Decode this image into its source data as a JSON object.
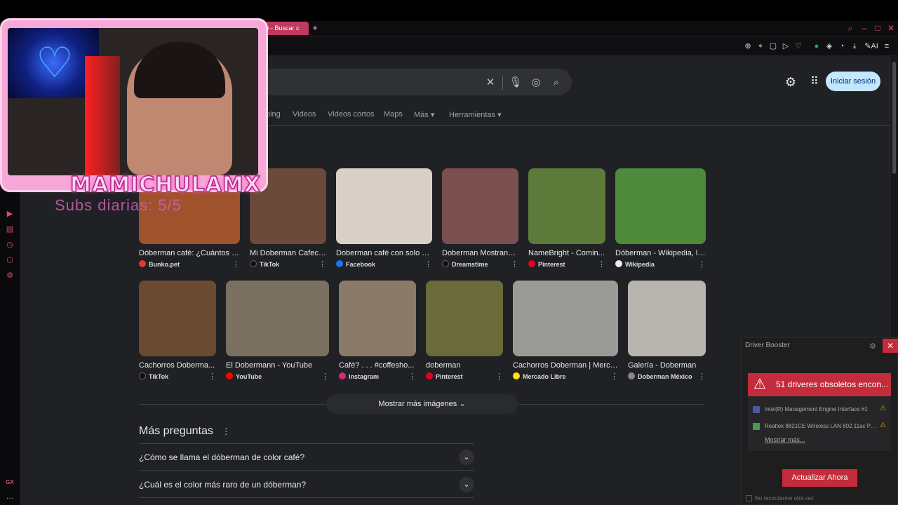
{
  "browser": {
    "active_tab_title": "fe - Buscar c",
    "new_tab_icon": "plus-icon"
  },
  "google": {
    "signin_label": "Iniciar sesión",
    "nav_tabs": [
      "ping",
      "Videos",
      "Videos cortos",
      "Maps",
      "Más ▾",
      "Herramientas ▾"
    ],
    "more_images": "Mostrar más imágenes",
    "paa_title": "Más preguntas",
    "paa": [
      "¿Cómo se llama el dóberman de color café?",
      "¿Cuál es el color más raro de un dóberman?"
    ],
    "row1": [
      {
        "caption": "Dóberman café: ¿Cuántos a...",
        "source": "Bunko.pet",
        "color": "#a0522d",
        "favicon": "#e33"
      },
      {
        "caption": "Mi Doberman Cafeci...",
        "source": "TikTok",
        "color": "#6b4a3a",
        "favicon": "#111"
      },
      {
        "caption": "Doberman café con solo d...",
        "source": "Facebook",
        "color": "#d8d0c6",
        "favicon": "#1877f2"
      },
      {
        "caption": "Doberman Mostrand...",
        "source": "Dreamstime",
        "color": "#7a5050",
        "favicon": "#111"
      },
      {
        "caption": "NameBright - Comin...",
        "source": "Pinterest",
        "color": "#5c7a3a",
        "favicon": "#e60023"
      },
      {
        "caption": "Dóberman - Wikipedia, la...",
        "source": "Wikipedia",
        "color": "#4e8a3c",
        "favicon": "#eee"
      }
    ],
    "row2": [
      {
        "caption": "Cachorros Doberma...",
        "source": "TikTok",
        "color": "#6a4a30",
        "favicon": "#111"
      },
      {
        "caption": "El Dobermann - YouTube",
        "source": "YouTube",
        "color": "#7a7060",
        "favicon": "#f00"
      },
      {
        "caption": "Café? . . . #coffesho...",
        "source": "Instagram",
        "color": "#8a7a68",
        "favicon": "#d62976"
      },
      {
        "caption": "doberman",
        "source": "Pinterest",
        "color": "#6a6a3a",
        "favicon": "#e60023"
      },
      {
        "caption": "Cachorros Doberman | Merca...",
        "source": "Mercado Libre",
        "color": "#9a9a96",
        "favicon": "#ffe600"
      },
      {
        "caption": "Galería - Doberman",
        "source": "Doberman México",
        "color": "#b8b4ae",
        "favicon": "#888"
      }
    ]
  },
  "overlay": {
    "streamer": "MAMICHULAMX",
    "subs": "Subs diarias: 5/5"
  },
  "driver_booster": {
    "title": "Driver Booster",
    "alert": "51 driveres obsoletos encon...",
    "items": [
      "Intel(R) Management Engine Interface #1",
      "Realtek 8821CE Wireless LAN 802.11ac PCI-E"
    ],
    "show_more": "Mostrar más...",
    "update_label": "Actualizar Ahora",
    "no_record": "No recordarme otra vez"
  }
}
